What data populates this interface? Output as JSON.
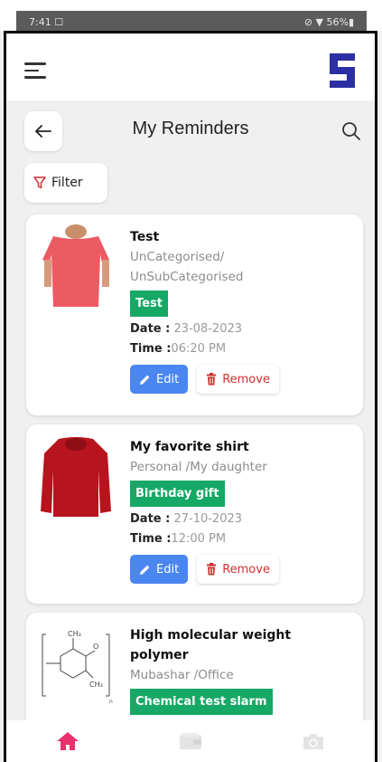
{
  "status_bar": {
    "time": "7:41 ☐",
    "right": "⊘ ▼ 56%▮"
  },
  "header": {
    "title": "My Reminders",
    "filter_label": "Filter"
  },
  "reminders": [
    {
      "title": "Test",
      "category": "UnCategorised/",
      "subcategory": "UnSubCategorised",
      "tag": "Test",
      "date_label": "Date :",
      "date": " 23-08-2023",
      "time_label": "Time :",
      "time": "06:20 PM",
      "edit_label": "Edit",
      "remove_label": "Remove"
    },
    {
      "title": "My favorite shirt",
      "category": "Personal /My daughter",
      "tag": "Birthday gift",
      "date_label": "Date :",
      "date": " 27-10-2023",
      "time_label": "Time :",
      "time": "12:00 PM",
      "edit_label": "Edit",
      "remove_label": "Remove"
    },
    {
      "title_line1": "High molecular weight",
      "title_line2": "polymer",
      "category": "Mubashar /Office",
      "tag": "Chemical test slarm"
    }
  ],
  "colors": {
    "accent_green": "#16a865",
    "edit_blue": "#4a86f0",
    "remove_red": "#d32f2f",
    "home_pink": "#e8326b",
    "logo_blue": "#2b2fa3"
  },
  "icons": [
    "menu-icon",
    "app-logo",
    "back-arrow-icon",
    "search-icon",
    "filter-icon",
    "pencil-icon",
    "trash-icon",
    "home-icon",
    "wallet-icon",
    "camera-icon"
  ]
}
